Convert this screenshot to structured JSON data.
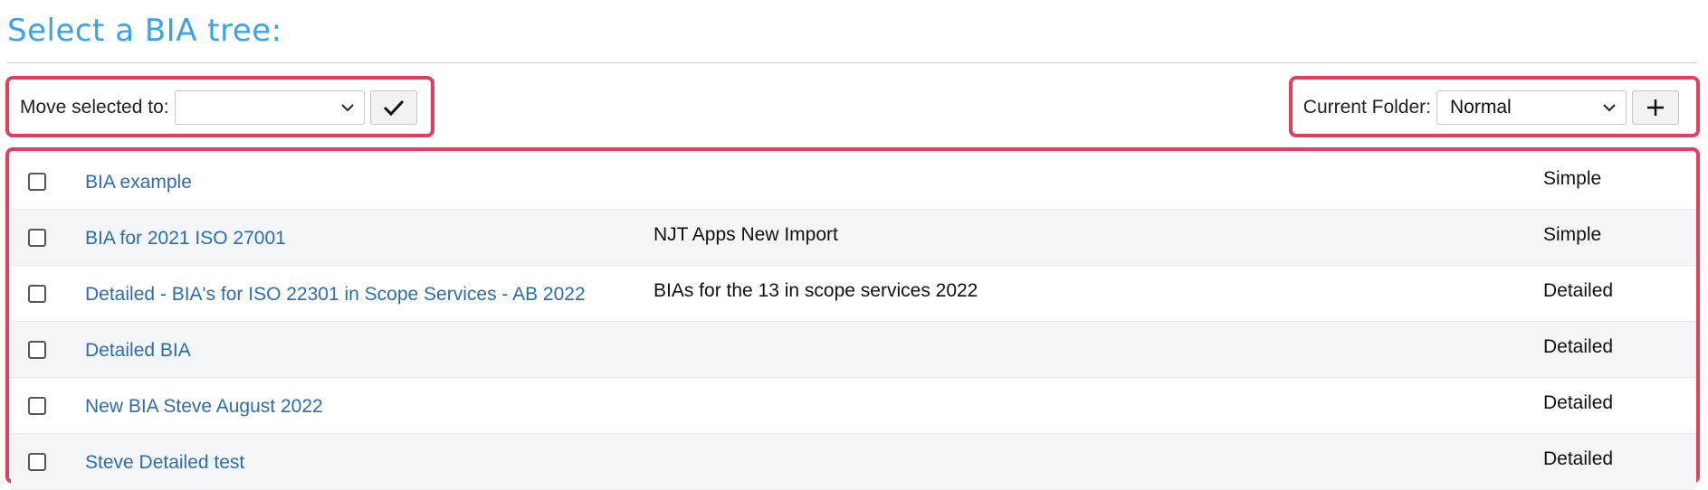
{
  "page": {
    "title": "Select a BIA tree:"
  },
  "toolbar": {
    "move_label": "Move selected to:",
    "move_value": "",
    "confirm_icon": "check-icon",
    "folder_label": "Current Folder:",
    "folder_value": "Normal",
    "add_icon": "plus-icon"
  },
  "colors": {
    "title": "#3aa3e3",
    "link": "#2a6db0",
    "highlight": "#e0405e",
    "row_alt": "#f4f5f7"
  },
  "trees": [
    {
      "name": "BIA example",
      "description": "",
      "type": "Simple"
    },
    {
      "name": "BIA for 2021 ISO 27001",
      "description": "NJT Apps New Import",
      "type": "Simple"
    },
    {
      "name": "Detailed - BIA's for ISO 22301 in Scope Services - AB 2022",
      "description": "BIAs for the 13 in scope services 2022",
      "type": "Detailed"
    },
    {
      "name": "Detailed BIA",
      "description": "",
      "type": "Detailed"
    },
    {
      "name": "New BIA Steve August 2022",
      "description": "",
      "type": "Detailed"
    },
    {
      "name": "Steve Detailed test",
      "description": "",
      "type": "Detailed"
    }
  ]
}
